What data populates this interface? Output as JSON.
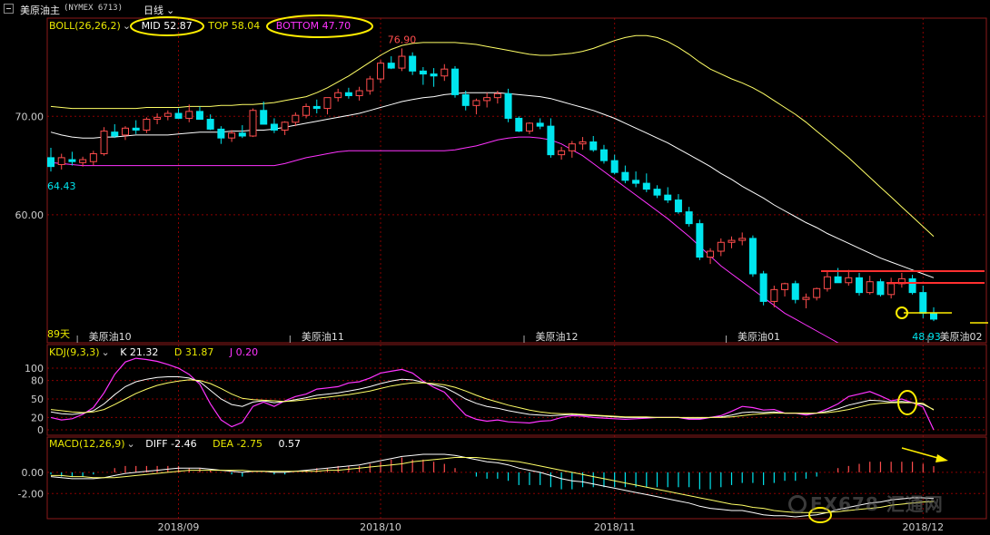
{
  "header": {
    "instrument": "美原油主",
    "code": "(NYMEX 6713)",
    "period": "日线"
  },
  "indicators": {
    "boll": {
      "label": "BOLL(26,26,2)",
      "mid": "MID 52.87",
      "top": "TOP 58.04",
      "bottom": "BOTTOM 47.70"
    },
    "kdj": {
      "label": "KDJ(9,3,3)",
      "k": "K 21.32",
      "d": "D 31.87",
      "j": "J 0.20"
    },
    "macd": {
      "label": "MACD(12,26,9)",
      "diff": "DIFF -2.46",
      "dea": "DEA -2.75",
      "macd": "0.57"
    }
  },
  "price_panel": {
    "y_ticks": [
      "70.00",
      "60.00"
    ],
    "high_label": "76.90",
    "low_label_left": "64.43",
    "low_label_right": "48.93",
    "days_label": "89天",
    "contract_labels": [
      "美原油10",
      "美原油11",
      "美原油12",
      "美原油01",
      "美原油02"
    ]
  },
  "kdj_panel": {
    "y_ticks": [
      "100",
      "80",
      "50",
      "20",
      "0"
    ]
  },
  "macd_panel": {
    "y_ticks": [
      "0.00",
      "-2.00"
    ]
  },
  "x_axis": {
    "labels": [
      "2018/09",
      "2018/10",
      "2018/11",
      "2018/12"
    ]
  },
  "watermark": "FX678 汇通网",
  "colors": {
    "up": "#ff4d4d",
    "down": "#00e5ee",
    "mid": "#ffffff",
    "top": "#ffff66",
    "bottom": "#ff33ff",
    "label_yellow": "#e8e800",
    "magenta": "#ff33ff",
    "grid": "#8b0000",
    "annotation": "#ffee00",
    "resistance": "#ff3030"
  },
  "chart_data": {
    "type": "candlestick",
    "ylim": [
      47.0,
      78.5
    ],
    "candles": [
      [
        65.8,
        66.8,
        64.4,
        64.9
      ],
      [
        65.1,
        66.2,
        64.6,
        65.8
      ],
      [
        65.6,
        66.4,
        65.0,
        65.4
      ],
      [
        65.3,
        65.9,
        64.9,
        65.6
      ],
      [
        65.4,
        66.5,
        65.0,
        66.2
      ],
      [
        66.2,
        68.9,
        66.0,
        68.5
      ],
      [
        68.4,
        69.2,
        67.8,
        68.0
      ],
      [
        68.1,
        69.0,
        67.6,
        68.8
      ],
      [
        68.8,
        69.6,
        68.2,
        68.6
      ],
      [
        68.6,
        69.9,
        68.3,
        69.7
      ],
      [
        69.7,
        70.3,
        69.2,
        69.9
      ],
      [
        70.0,
        70.6,
        69.6,
        70.3
      ],
      [
        70.3,
        70.8,
        69.9,
        69.8
      ],
      [
        69.8,
        71.2,
        69.4,
        70.5
      ],
      [
        70.5,
        71.0,
        69.8,
        69.7
      ],
      [
        69.7,
        70.2,
        68.6,
        68.7
      ],
      [
        68.7,
        69.0,
        67.2,
        67.8
      ],
      [
        67.8,
        68.6,
        67.4,
        68.3
      ],
      [
        68.3,
        69.1,
        67.8,
        68.0
      ],
      [
        68.0,
        70.8,
        67.9,
        70.6
      ],
      [
        70.6,
        71.5,
        70.2,
        69.2
      ],
      [
        69.2,
        69.8,
        68.3,
        68.6
      ],
      [
        68.6,
        69.5,
        68.1,
        69.4
      ],
      [
        69.4,
        70.4,
        69.0,
        70.1
      ],
      [
        70.1,
        71.3,
        69.8,
        71.0
      ],
      [
        71.0,
        71.7,
        70.3,
        70.8
      ],
      [
        70.8,
        71.9,
        70.2,
        71.9
      ],
      [
        71.9,
        72.8,
        71.5,
        72.4
      ],
      [
        72.4,
        72.9,
        71.8,
        72.1
      ],
      [
        72.1,
        73.0,
        71.6,
        72.6
      ],
      [
        72.6,
        74.1,
        72.2,
        73.8
      ],
      [
        73.8,
        75.7,
        73.4,
        75.4
      ],
      [
        75.4,
        76.1,
        74.8,
        74.9
      ],
      [
        74.9,
        76.9,
        74.6,
        76.1
      ],
      [
        76.1,
        76.5,
        74.2,
        74.6
      ],
      [
        74.6,
        75.0,
        73.2,
        74.3
      ],
      [
        74.3,
        74.9,
        73.0,
        74.1
      ],
      [
        74.1,
        75.3,
        73.6,
        74.8
      ],
      [
        74.8,
        75.1,
        71.9,
        72.2
      ],
      [
        72.2,
        72.6,
        70.6,
        71.1
      ],
      [
        71.1,
        71.8,
        70.2,
        71.6
      ],
      [
        71.6,
        72.4,
        70.9,
        71.9
      ],
      [
        71.9,
        72.6,
        71.3,
        72.3
      ],
      [
        72.3,
        72.8,
        69.4,
        69.8
      ],
      [
        69.8,
        70.0,
        68.4,
        68.5
      ],
      [
        68.5,
        69.4,
        68.2,
        69.3
      ],
      [
        69.3,
        69.8,
        68.7,
        69.0
      ],
      [
        69.0,
        69.8,
        65.8,
        66.1
      ],
      [
        66.1,
        66.9,
        65.6,
        66.5
      ],
      [
        66.5,
        67.5,
        65.8,
        67.2
      ],
      [
        67.2,
        67.9,
        66.6,
        67.4
      ],
      [
        67.4,
        68.0,
        66.4,
        66.6
      ],
      [
        66.6,
        67.1,
        65.2,
        65.5
      ],
      [
        65.5,
        66.1,
        64.1,
        64.3
      ],
      [
        64.3,
        65.0,
        63.2,
        63.5
      ],
      [
        63.5,
        64.4,
        62.8,
        63.2
      ],
      [
        63.2,
        64.2,
        62.3,
        62.6
      ],
      [
        62.6,
        63.0,
        61.7,
        62.0
      ],
      [
        62.0,
        62.8,
        61.2,
        61.5
      ],
      [
        61.5,
        62.1,
        60.1,
        60.3
      ],
      [
        60.3,
        60.8,
        58.8,
        59.1
      ],
      [
        59.1,
        59.5,
        55.4,
        55.7
      ],
      [
        55.7,
        56.6,
        55.0,
        56.3
      ],
      [
        56.3,
        57.6,
        55.8,
        57.2
      ],
      [
        57.2,
        57.8,
        56.6,
        57.4
      ],
      [
        57.4,
        58.2,
        56.9,
        57.6
      ],
      [
        57.6,
        57.9,
        53.7,
        54.0
      ],
      [
        54.0,
        54.3,
        50.8,
        51.2
      ],
      [
        51.2,
        52.8,
        50.6,
        52.4
      ],
      [
        52.4,
        53.1,
        51.7,
        53.0
      ],
      [
        53.0,
        53.3,
        51.0,
        51.4
      ],
      [
        51.4,
        52.0,
        50.5,
        51.6
      ],
      [
        51.6,
        52.6,
        51.3,
        52.5
      ],
      [
        52.5,
        54.2,
        52.2,
        53.7
      ],
      [
        53.7,
        54.6,
        53.1,
        53.1
      ],
      [
        53.1,
        54.4,
        52.8,
        53.6
      ],
      [
        53.6,
        54.1,
        51.8,
        52.1
      ],
      [
        52.1,
        53.8,
        51.9,
        53.2
      ],
      [
        53.2,
        53.5,
        51.7,
        51.9
      ],
      [
        51.9,
        53.6,
        51.5,
        53.0
      ],
      [
        53.0,
        54.1,
        52.6,
        53.5
      ],
      [
        53.5,
        53.9,
        51.9,
        52.1
      ],
      [
        52.1,
        52.8,
        49.5,
        50.0
      ],
      [
        50.0,
        50.6,
        49.2,
        49.4
      ]
    ],
    "series": [
      {
        "name": "MID",
        "values": [
          68.4,
          68.1,
          67.9,
          67.8,
          67.8,
          67.9,
          67.9,
          68.0,
          68.1,
          68.1,
          68.1,
          68.1,
          68.2,
          68.3,
          68.4,
          68.4,
          68.4,
          68.5,
          68.5,
          68.6,
          68.6,
          68.7,
          68.9,
          69.1,
          69.3,
          69.5,
          69.7,
          69.9,
          70.1,
          70.3,
          70.6,
          70.9,
          71.2,
          71.5,
          71.7,
          71.9,
          72.0,
          72.2,
          72.3,
          72.4,
          72.4,
          72.4,
          72.4,
          72.3,
          72.2,
          72.1,
          72.0,
          71.8,
          71.5,
          71.2,
          70.9,
          70.6,
          70.2,
          69.8,
          69.3,
          68.8,
          68.3,
          67.8,
          67.3,
          66.7,
          66.1,
          65.5,
          64.9,
          64.2,
          63.6,
          62.9,
          62.3,
          61.7,
          61.0,
          60.4,
          59.8,
          59.2,
          58.7,
          58.1,
          57.6,
          57.1,
          56.6,
          56.1,
          55.6,
          55.2,
          54.8,
          54.4,
          54.0,
          53.6
        ]
      },
      {
        "name": "TOP",
        "values": [
          71.0,
          70.9,
          70.8,
          70.8,
          70.8,
          70.8,
          70.8,
          70.8,
          70.8,
          70.9,
          70.9,
          70.9,
          70.9,
          71.0,
          71.0,
          71.0,
          71.1,
          71.1,
          71.2,
          71.2,
          71.3,
          71.4,
          71.6,
          71.8,
          72.0,
          72.4,
          72.9,
          73.5,
          74.1,
          74.8,
          75.5,
          76.2,
          76.8,
          77.2,
          77.4,
          77.5,
          77.5,
          77.5,
          77.5,
          77.4,
          77.3,
          77.1,
          76.9,
          76.7,
          76.5,
          76.3,
          76.2,
          76.2,
          76.3,
          76.4,
          76.6,
          76.9,
          77.3,
          77.7,
          78.0,
          78.2,
          78.2,
          78.0,
          77.6,
          77.0,
          76.3,
          75.5,
          74.8,
          74.3,
          73.8,
          73.4,
          72.9,
          72.3,
          71.6,
          70.9,
          70.2,
          69.4,
          68.5,
          67.6,
          66.7,
          65.8,
          64.8,
          63.8,
          62.8,
          61.8,
          60.8,
          59.8,
          58.8,
          57.8
        ]
      },
      {
        "name": "BOTTOM",
        "values": [
          65.3,
          65.2,
          65.1,
          65.0,
          65.0,
          65.0,
          65.0,
          65.0,
          65.0,
          65.0,
          65.0,
          65.0,
          65.0,
          65.0,
          65.0,
          65.0,
          65.0,
          65.0,
          65.0,
          65.0,
          65.0,
          65.0,
          65.2,
          65.5,
          65.8,
          66.0,
          66.2,
          66.4,
          66.5,
          66.5,
          66.5,
          66.5,
          66.5,
          66.5,
          66.5,
          66.5,
          66.5,
          66.5,
          66.6,
          66.8,
          67.0,
          67.3,
          67.6,
          67.8,
          67.9,
          67.9,
          67.8,
          67.6,
          67.2,
          66.6,
          66.0,
          65.2,
          64.4,
          63.6,
          62.8,
          62.0,
          61.2,
          60.4,
          59.6,
          58.7,
          57.8,
          56.8,
          55.8,
          54.8,
          54.0,
          53.2,
          52.4,
          51.6,
          50.8,
          50.0,
          49.4,
          48.8,
          48.2,
          47.6,
          47.0,
          46.4,
          45.8,
          45.3,
          44.8,
          44.3,
          43.8,
          43.3,
          42.9,
          42.5
        ]
      }
    ],
    "kdj": {
      "k": [
        29,
        26,
        25,
        27,
        31,
        42,
        57,
        70,
        78,
        82,
        85,
        86,
        86,
        84,
        78,
        64,
        50,
        41,
        38,
        45,
        47,
        44,
        46,
        49,
        52,
        56,
        58,
        60,
        63,
        66,
        70,
        75,
        79,
        82,
        81,
        77,
        73,
        69,
        60,
        50,
        43,
        38,
        35,
        31,
        28,
        25,
        24,
        23,
        24,
        25,
        24,
        23,
        22,
        21,
        20,
        20,
        20,
        20,
        20,
        20,
        19,
        19,
        20,
        21,
        24,
        28,
        29,
        28,
        29,
        27,
        27,
        26,
        27,
        30,
        34,
        40,
        44,
        48,
        47,
        45,
        46,
        44,
        41,
        33
      ],
      "d": [
        33,
        31,
        29,
        28,
        29,
        33,
        41,
        50,
        59,
        66,
        72,
        76,
        79,
        81,
        80,
        75,
        67,
        58,
        51,
        49,
        48,
        47,
        46,
        47,
        49,
        51,
        53,
        55,
        57,
        60,
        63,
        67,
        71,
        74,
        76,
        76,
        75,
        73,
        69,
        63,
        56,
        50,
        45,
        40,
        36,
        32,
        29,
        27,
        26,
        26,
        25,
        24,
        23,
        22,
        21,
        21,
        21,
        20,
        20,
        20,
        20,
        20,
        20,
        20,
        21,
        23,
        25,
        26,
        27,
        27,
        27,
        27,
        27,
        28,
        30,
        33,
        37,
        41,
        43,
        44,
        44,
        44,
        43,
        32
      ],
      "j": [
        20,
        16,
        18,
        25,
        36,
        60,
        90,
        110,
        116,
        114,
        111,
        106,
        100,
        90,
        74,
        42,
        16,
        5,
        12,
        38,
        45,
        38,
        47,
        54,
        58,
        66,
        68,
        70,
        76,
        78,
        84,
        92,
        95,
        98,
        92,
        79,
        69,
        61,
        42,
        24,
        17,
        14,
        16,
        13,
        12,
        11,
        14,
        15,
        20,
        23,
        22,
        20,
        19,
        18,
        17,
        18,
        19,
        20,
        20,
        20,
        17,
        17,
        20,
        23,
        30,
        38,
        36,
        32,
        33,
        27,
        27,
        24,
        27,
        34,
        42,
        54,
        58,
        62,
        55,
        47,
        50,
        44,
        37,
        0
      ]
    },
    "macd": {
      "diff": [
        -0.4,
        -0.5,
        -0.6,
        -0.6,
        -0.6,
        -0.5,
        -0.3,
        -0.1,
        0.0,
        0.1,
        0.2,
        0.3,
        0.4,
        0.4,
        0.4,
        0.3,
        0.2,
        0.1,
        0.0,
        0.1,
        0.1,
        0.0,
        0.0,
        0.1,
        0.2,
        0.3,
        0.4,
        0.5,
        0.6,
        0.7,
        0.9,
        1.1,
        1.3,
        1.5,
        1.6,
        1.7,
        1.7,
        1.7,
        1.6,
        1.4,
        1.2,
        1.0,
        0.9,
        0.7,
        0.4,
        0.2,
        0.0,
        -0.3,
        -0.6,
        -0.8,
        -0.9,
        -1.1,
        -1.3,
        -1.5,
        -1.7,
        -1.9,
        -2.1,
        -2.3,
        -2.5,
        -2.7,
        -2.9,
        -3.2,
        -3.4,
        -3.5,
        -3.6,
        -3.6,
        -3.8,
        -4.0,
        -4.1,
        -4.1,
        -4.2,
        -4.1,
        -4.0,
        -3.8,
        -3.5,
        -3.3,
        -3.1,
        -2.9,
        -2.8,
        -2.6,
        -2.5,
        -2.4,
        -2.4,
        -2.46
      ],
      "dea": [
        -0.3,
        -0.3,
        -0.4,
        -0.4,
        -0.5,
        -0.5,
        -0.5,
        -0.4,
        -0.3,
        -0.2,
        -0.1,
        0.0,
        0.1,
        0.2,
        0.2,
        0.2,
        0.2,
        0.2,
        0.2,
        0.1,
        0.1,
        0.1,
        0.1,
        0.1,
        0.1,
        0.1,
        0.2,
        0.2,
        0.3,
        0.4,
        0.5,
        0.6,
        0.7,
        0.8,
        1.0,
        1.1,
        1.2,
        1.3,
        1.4,
        1.4,
        1.4,
        1.3,
        1.2,
        1.1,
        1.0,
        0.8,
        0.6,
        0.4,
        0.2,
        0.0,
        -0.2,
        -0.4,
        -0.6,
        -0.8,
        -1.0,
        -1.2,
        -1.4,
        -1.6,
        -1.8,
        -2.0,
        -2.2,
        -2.4,
        -2.6,
        -2.8,
        -3.0,
        -3.1,
        -3.3,
        -3.4,
        -3.6,
        -3.7,
        -3.8,
        -3.8,
        -3.8,
        -3.8,
        -3.7,
        -3.6,
        -3.5,
        -3.4,
        -3.3,
        -3.1,
        -3.0,
        -2.9,
        -2.8,
        -2.75
      ],
      "ylim": [
        -4.2,
        2.3
      ]
    },
    "x_ticks": [
      {
        "label": "2018/09",
        "index": 12
      },
      {
        "label": "2018/10",
        "index": 31
      },
      {
        "label": "2018/11",
        "index": 53
      },
      {
        "label": "2018/12",
        "index": 82
      }
    ],
    "contract_ticks": [
      {
        "label": "美原油10",
        "index": 3
      },
      {
        "label": "美原油11",
        "index": 23
      },
      {
        "label": "美原油12",
        "index": 45
      },
      {
        "label": "美原油01",
        "index": 64
      },
      {
        "label": "美原油02",
        "index": 83
      }
    ]
  }
}
